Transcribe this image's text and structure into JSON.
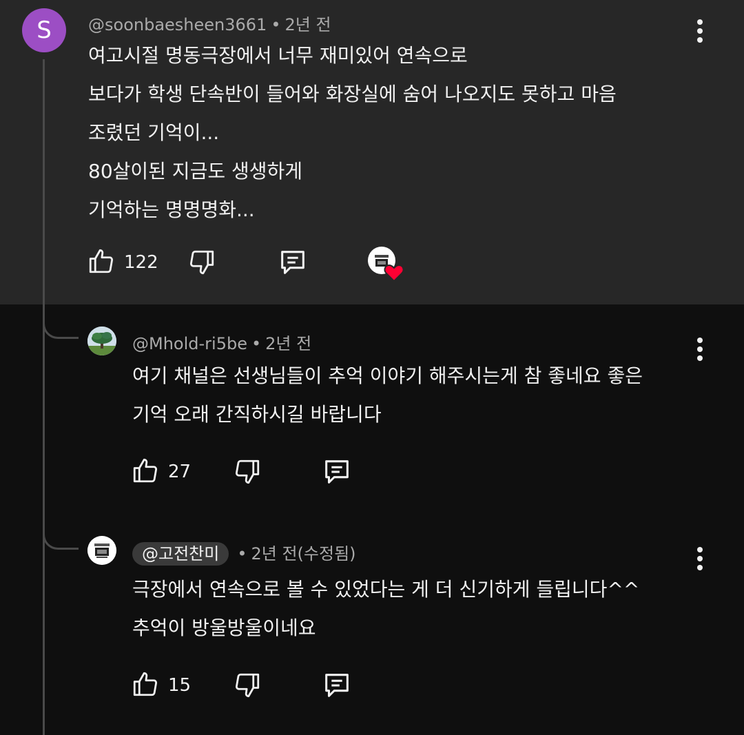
{
  "comment": {
    "avatar_letter": "S",
    "avatar_color": "#9c4ec4",
    "author": "@soonbaesheen3661",
    "time": "2년 전",
    "lines": [
      "여고시절 명동극장에서 너무 재미있어 연속으로",
      "보다가 학생 단속반이 들어와 화장실에 숨어 나오지도 못하고 마음",
      "조렸던 기억이...",
      "80살이된 지금도 생생하게",
      "기억하는 명명명화..."
    ],
    "likes": "122",
    "creator_heart": true
  },
  "replies": [
    {
      "author": "@Mhold-ri5be",
      "time": "2년 전",
      "lines": [
        "여기 채널은 선생님들이 추억 이야기 해주시는게 참 좋네요 좋은",
        "기억 오래 간직하시길 바랍니다"
      ],
      "likes": "27"
    },
    {
      "author": "@고전찬미",
      "time": "2년 전(수정됨)",
      "lines": [
        "극장에서 연속으로 볼 수 있었다는 게 더 신기하게 들립니다^^",
        "추억이 방울방울이네요"
      ],
      "likes": "15",
      "is_creator": true
    }
  ],
  "colors": {
    "top_bg": "#272727",
    "page_bg": "#0f0f0f",
    "meta_text": "#aaaaaa",
    "heart": "#ff0033"
  }
}
